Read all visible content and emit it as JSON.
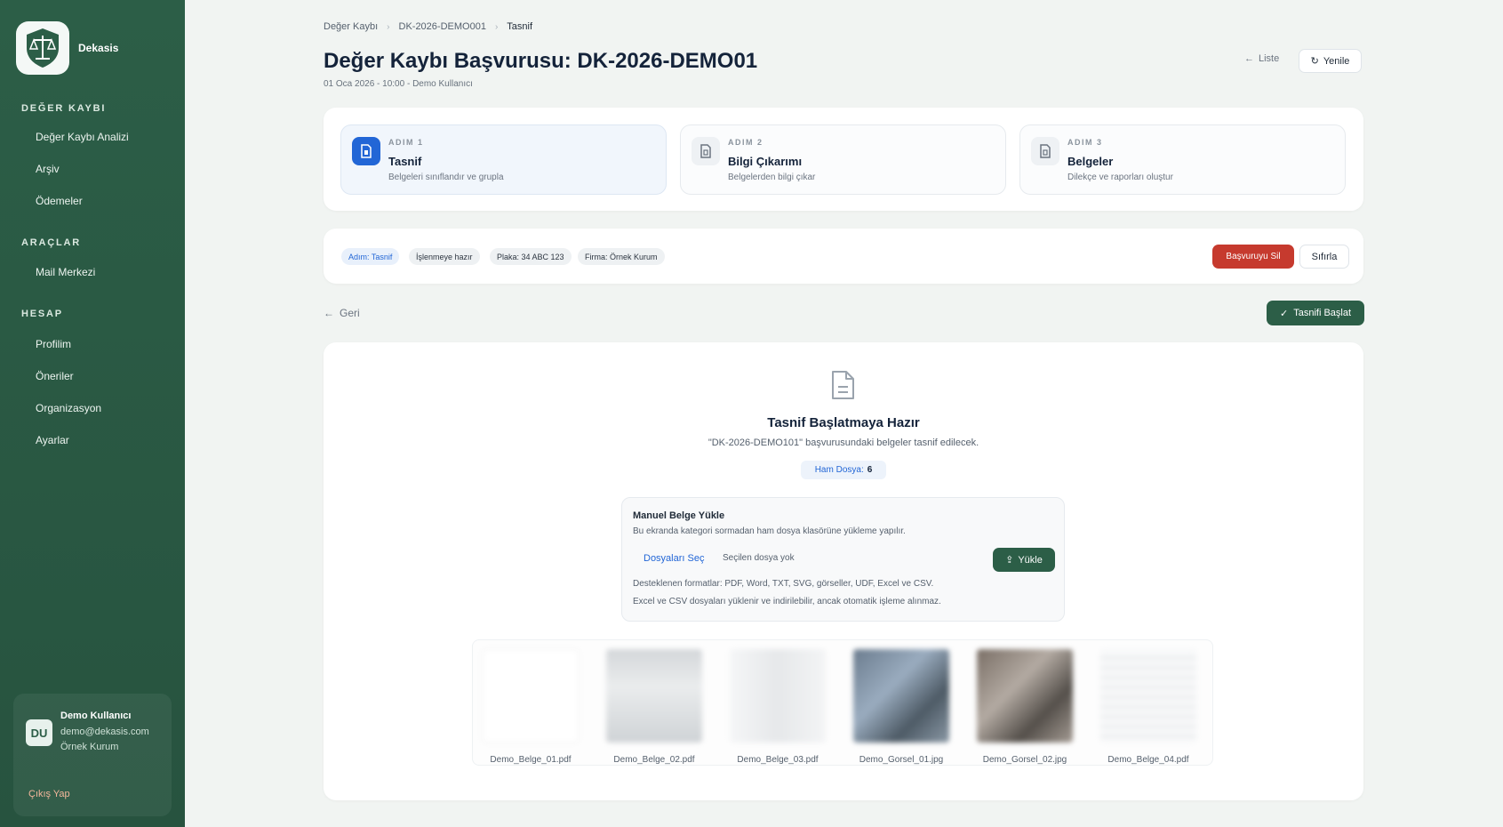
{
  "sidebar": {
    "brand": "Dekasis",
    "sections": [
      {
        "title": "DEĞER KAYBI",
        "items": [
          "Değer Kaybı Analizi",
          "Arşiv",
          "Ödemeler"
        ]
      },
      {
        "title": "ARAÇLAR",
        "items": [
          "Mail Merkezi"
        ]
      },
      {
        "title": "HESAP",
        "items": [
          "Profilim",
          "Öneriler",
          "Organizasyon",
          "Ayarlar"
        ]
      }
    ],
    "user": {
      "initials": "DU",
      "name": "Demo Kullanıcı",
      "email": "demo@dekasis.com",
      "org": "Örnek Kurum",
      "logout": "Çıkış Yap"
    }
  },
  "breadcrumb": [
    "Değer Kaybı",
    "DK-2026-DEMO001",
    "Tasnif"
  ],
  "header": {
    "title": "Değer Kaybı Başvurusu: DK-2026-DEMO01",
    "subtitle": "01 Oca 2026 - 10:00 - Demo Kullanıcı",
    "list_label": "Liste",
    "refresh_label": "Yenile"
  },
  "steps": [
    {
      "kicker": "ADIM 1",
      "title": "Tasnif",
      "desc": "Belgeleri sınıflandır ve grupla"
    },
    {
      "kicker": "ADIM 2",
      "title": "Bilgi Çıkarımı",
      "desc": "Belgelerden bilgi çıkar"
    },
    {
      "kicker": "ADIM 3",
      "title": "Belgeler",
      "desc": "Dilekçe ve raporları oluştur"
    }
  ],
  "status": {
    "chips": [
      "Adım: Tasnif",
      "İşlenmeye hazır",
      "Plaka: 34 ABC 123",
      "Firma: Örnek Kurum"
    ],
    "delete_label": "Başvuruyu Sil",
    "reset_label": "Sıfırla"
  },
  "actions": {
    "back_label": "Geri",
    "start_label": "Tasnifi Başlat"
  },
  "main": {
    "title": "Tasnif Başlatmaya Hazır",
    "subtitle": "\"DK-2026-DEMO101\" başvurusundaki belgeler tasnif edilecek.",
    "raw_label": "Ham Dosya:",
    "raw_count": "6",
    "upload": {
      "title": "Manuel Belge Yükle",
      "desc": "Bu ekranda kategori sormadan ham dosya klasörüne yükleme yapılır.",
      "choose_label": "Dosyaları Seç",
      "no_file_label": "Seçilen dosya yok",
      "upload_label": "Yükle",
      "note1": "Desteklenen formatlar: PDF, Word, TXT, SVG, görseller, UDF, Excel ve CSV.",
      "note2": "Excel ve CSV dosyaları yüklenir ve indirilebilir, ancak otomatik işleme alınmaz."
    },
    "files": [
      "Demo_Belge_01.pdf",
      "Demo_Belge_02.pdf",
      "Demo_Belge_03.pdf",
      "Demo_Gorsel_01.jpg",
      "Demo_Gorsel_02.jpg",
      "Demo_Belge_04.pdf"
    ]
  },
  "colors": {
    "sidebar": "#2c5e47",
    "primary": "#2c5e47",
    "accent_blue": "#2266d6",
    "danger": "#c63a2e"
  }
}
